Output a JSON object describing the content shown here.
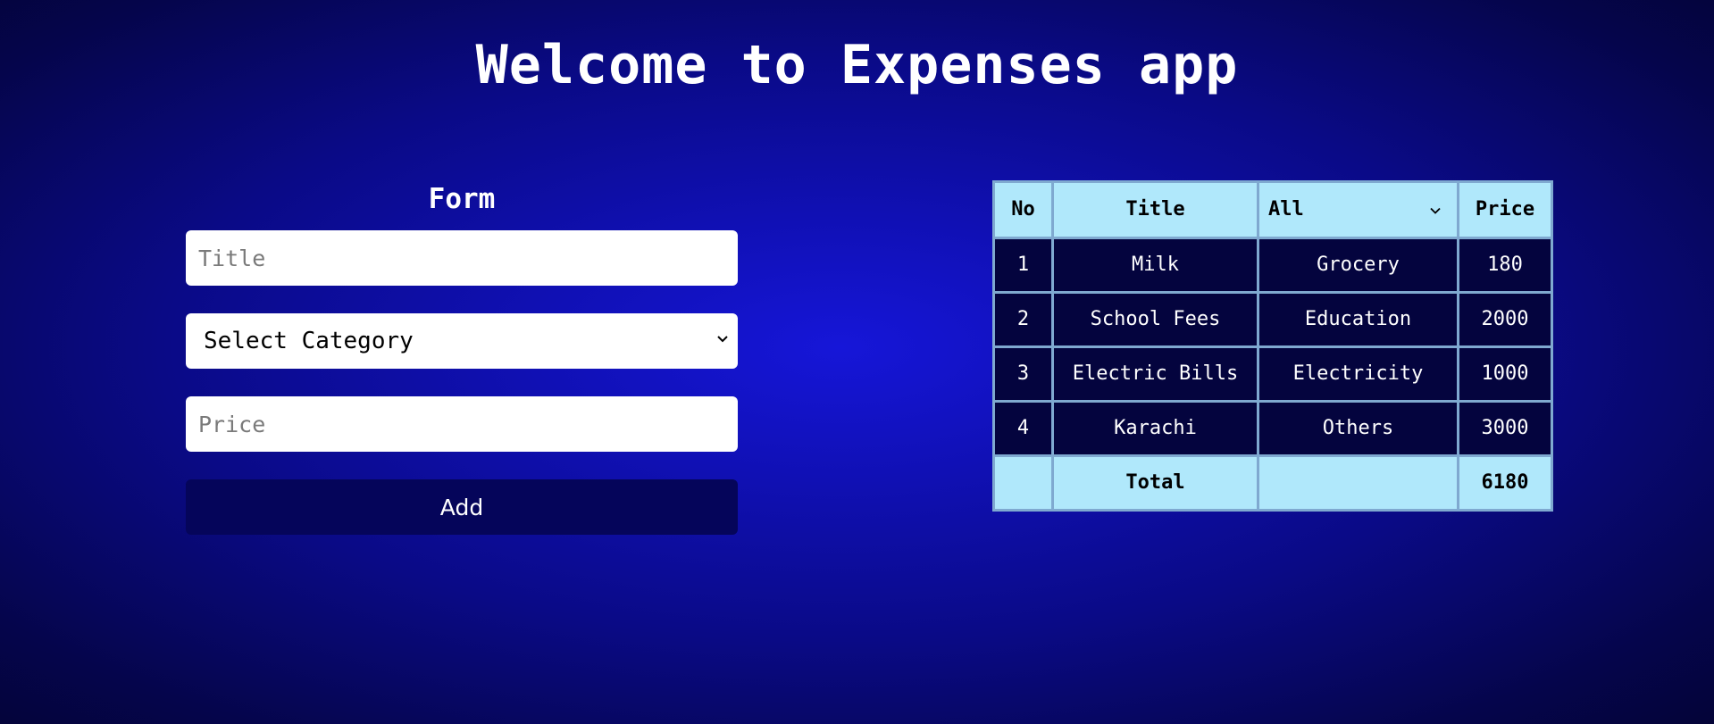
{
  "app": {
    "title": "Welcome to Expenses app"
  },
  "form": {
    "heading": "Form",
    "title_placeholder": "Title",
    "category_selected": "Select Category",
    "price_placeholder": "Price",
    "add_label": "Add"
  },
  "table": {
    "headers": {
      "no": "No",
      "title": "Title",
      "category_filter": "All",
      "price": "Price"
    },
    "rows": [
      {
        "no": "1",
        "title": "Milk",
        "category": "Grocery",
        "price": "180"
      },
      {
        "no": "2",
        "title": "School Fees",
        "category": "Education",
        "price": "2000"
      },
      {
        "no": "3",
        "title": "Electric Bills",
        "category": "Electricity",
        "price": "1000"
      },
      {
        "no": "4",
        "title": "Karachi",
        "category": "Others",
        "price": "3000"
      }
    ],
    "footer": {
      "label": "Total",
      "total": "6180"
    }
  },
  "icons": {
    "category_select": "chevron-down-icon",
    "category_filter": "chevron-down-icon"
  },
  "colors": {
    "background_center": "#1616d8",
    "background_edge": "#040438",
    "table_header": "#b0e8fb",
    "table_body": "#04043e",
    "add_button": "#05055a"
  }
}
